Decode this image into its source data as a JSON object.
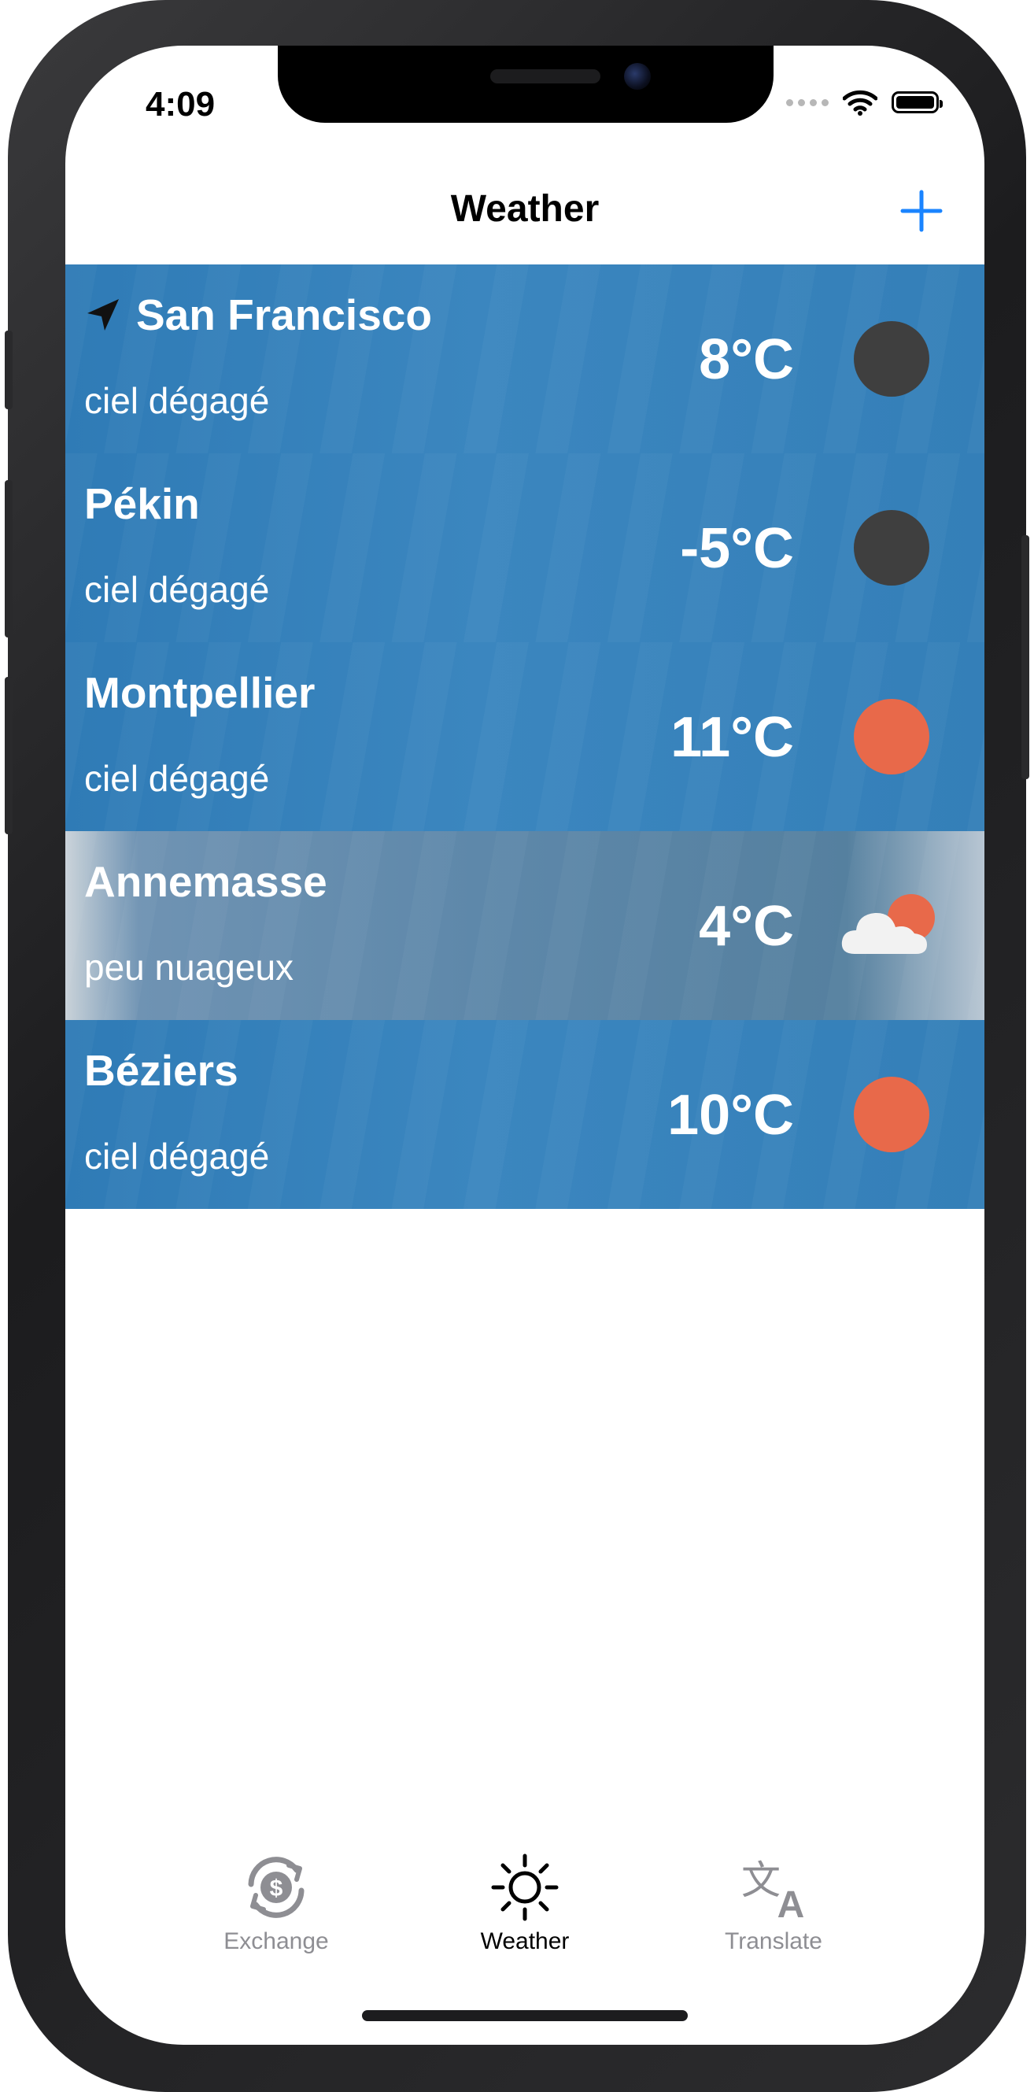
{
  "status_bar": {
    "time": "4:09"
  },
  "navbar": {
    "title": "Weather"
  },
  "colors": {
    "accent": "#1a84ff",
    "row_blue": "#3582bb",
    "clear_night": "#3f3f3f",
    "clear_day": "#e8694a",
    "tab_active": "#000000",
    "tab_inactive": "#8e8e93"
  },
  "cities": [
    {
      "name": "San Francisco",
      "description": "ciel dégagé",
      "temperature": "8°C",
      "icon": "moon-circle-icon",
      "current_location": true
    },
    {
      "name": "Pékin",
      "description": "ciel dégagé",
      "temperature": "-5°C",
      "icon": "moon-circle-icon",
      "current_location": false
    },
    {
      "name": "Montpellier",
      "description": "ciel dégagé",
      "temperature": "11°C",
      "icon": "sun-circle-icon",
      "current_location": false
    },
    {
      "name": "Annemasse",
      "description": "peu nuageux",
      "temperature": "4°C",
      "icon": "cloud-sun-icon",
      "current_location": false
    },
    {
      "name": "Béziers",
      "description": "ciel dégagé",
      "temperature": "10°C",
      "icon": "sun-circle-icon",
      "current_location": false
    }
  ],
  "tabs": [
    {
      "label": "Exchange",
      "icon": "currency-exchange-icon",
      "active": false
    },
    {
      "label": "Weather",
      "icon": "sun-icon",
      "active": true
    },
    {
      "label": "Translate",
      "icon": "translate-icon",
      "active": false
    }
  ]
}
